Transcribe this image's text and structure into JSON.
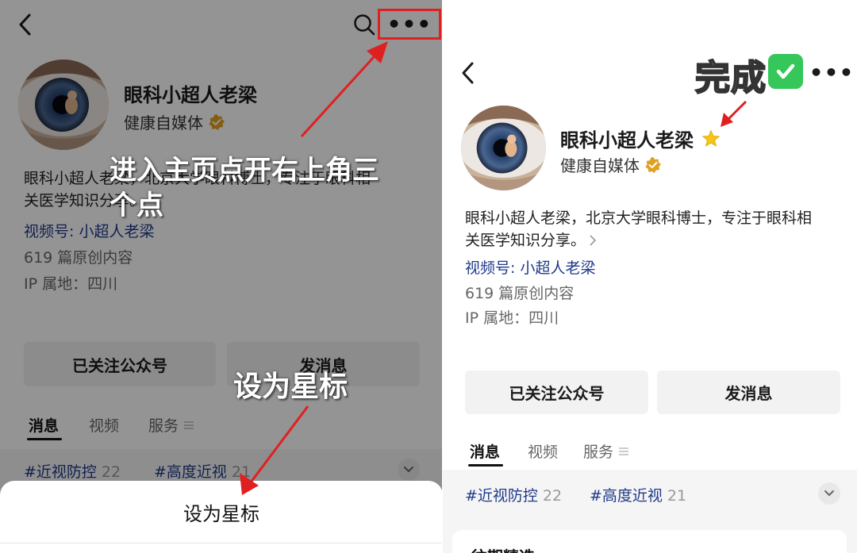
{
  "colors": {
    "link": "#1f3a8a",
    "verified_badge": "#e0a020",
    "star": "#f5c518",
    "annotation_red": "#e02020",
    "check_green": "#35c759"
  },
  "left": {
    "profile": {
      "name": "眼科小超人老梁",
      "category": "健康自媒体",
      "desc_line1": "眼科小超人老梁，北京大学眼科博士，专注于眼科相",
      "desc_line2": "关医学知识分享。",
      "video_channel": "视频号: 小超人老梁",
      "articles": "619 篇原创内容",
      "ip": "IP 属地：四川"
    },
    "buttons": {
      "follow": "已关注公众号",
      "message": "发消息"
    },
    "tabs": [
      "消息",
      "视频",
      "服务"
    ],
    "tags": [
      {
        "name": "#近视防控",
        "count": "22"
      },
      {
        "name": "#高度近视",
        "count": "21"
      }
    ],
    "sheet": {
      "item": "设为星标"
    },
    "annotations": {
      "line1": "进入主页点开右上角三",
      "line2": "个点",
      "set_star": "设为星标"
    }
  },
  "right": {
    "done_label": "完成",
    "profile": {
      "name": "眼科小超人老梁",
      "category": "健康自媒体",
      "desc_line1": "眼科小超人老梁，北京大学眼科博士，专注于眼科相",
      "desc_line2": "关医学知识分享。",
      "video_channel": "视频号: 小超人老梁",
      "articles": "619 篇原创内容",
      "ip": "IP 属地：四川"
    },
    "buttons": {
      "follow": "已关注公众号",
      "message": "发消息"
    },
    "tabs": [
      "消息",
      "视频",
      "服务"
    ],
    "tags": [
      {
        "name": "#近视防控",
        "count": "22"
      },
      {
        "name": "#高度近视",
        "count": "21"
      }
    ],
    "card_title": "往期精选"
  },
  "icons": {
    "back": "back-chevron-icon",
    "search": "search-icon",
    "more": "more-dots-icon",
    "verified": "verified-badge-icon",
    "star": "star-icon",
    "menu": "menu-lines-icon",
    "expand": "chevron-down-icon",
    "check": "check-mark-icon"
  }
}
